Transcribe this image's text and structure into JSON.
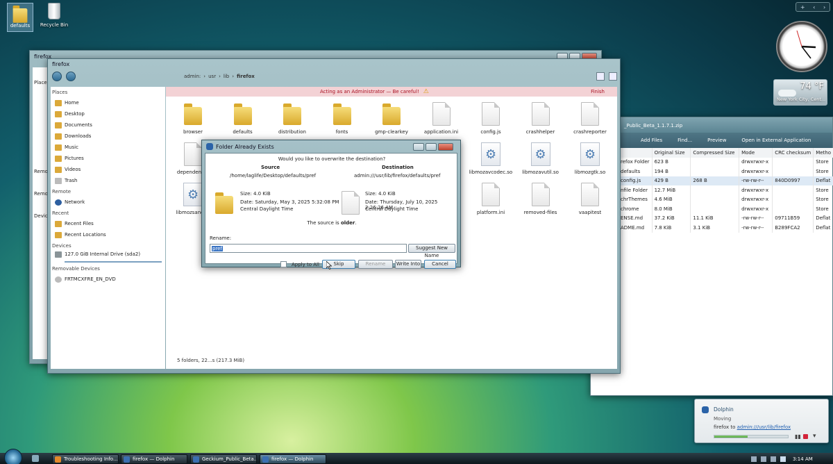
{
  "desktop": {
    "icons": [
      {
        "label": "defaults",
        "icon": "folder-icon"
      },
      {
        "label": "Recycle Bin",
        "icon": "recycle-bin-icon"
      }
    ]
  },
  "sidebar_gadget": {
    "plus": "+",
    "weather": {
      "temp": "74 °F",
      "location": "New York City, Cent..."
    }
  },
  "back_window": {
    "title": "firefox",
    "side_fragments": [
      "Place",
      "Remo",
      "Remo",
      "Devic"
    ]
  },
  "archive_window": {
    "title_fragment": "_Public_Beta_1.1.7.1.zip",
    "toolbar": [
      "Add Files",
      "Find...",
      "Preview",
      "Open in External Application"
    ],
    "columns": [
      "Original Size",
      "Compressed Size",
      "Mode",
      "CRC checksum",
      "Metho"
    ],
    "rows": [
      [
        "refox Folder",
        "623 B",
        "",
        "drwxrwxr-x",
        "",
        "Store"
      ],
      [
        "defaults",
        "194 B",
        "",
        "drwxrwxr-x",
        "",
        "Store"
      ],
      [
        "config.js",
        "429 B",
        "268 B",
        "-rw-rw-r--",
        "840D0997",
        "Deflat"
      ],
      [
        "nfile Folder",
        "12.7 MiB",
        "",
        "drwxrwxr-x",
        "",
        "Store"
      ],
      [
        "chrThemes",
        "4.6 MiB",
        "",
        "drwxrwxr-x",
        "",
        "Store"
      ],
      [
        "chrome",
        "8.0 MiB",
        "",
        "drwxrwxr-x",
        "",
        "Store"
      ],
      [
        "ENSE.md",
        "37.2 KiB",
        "11.1 KiB",
        "-rw-rw-r--",
        "09711B59",
        "Deflat"
      ],
      [
        "ADME.md",
        "7.8 KiB",
        "3.1 KiB",
        "-rw-rw-r--",
        "B289FCA2",
        "Deflat"
      ]
    ]
  },
  "dolphin": {
    "title": "firefox",
    "breadcrumb": [
      "admin:",
      "usr",
      "lib",
      "firefox"
    ],
    "admin_banner": "Acting as an Administrator — Be careful!",
    "admin_finish": "Finish",
    "places_header": "Places",
    "places": [
      "Home",
      "Desktop",
      "Documents",
      "Downloads",
      "Music",
      "Pictures",
      "Videos",
      "Trash"
    ],
    "remote_header": "Remote",
    "remote": [
      "Network"
    ],
    "recent_header": "Recent",
    "recent": [
      "Recent Files",
      "Recent Locations"
    ],
    "devices_header": "Devices",
    "devices": [
      "127.0 GiB Internal Drive (sda2)"
    ],
    "removable_header": "Removable Devices",
    "removable": [
      "FRTMCXFRE_EN_DVD"
    ],
    "files": [
      {
        "name": "browser",
        "kind": "folder"
      },
      {
        "name": "defaults",
        "kind": "folder"
      },
      {
        "name": "distribution",
        "kind": "folder"
      },
      {
        "name": "fonts",
        "kind": "folder"
      },
      {
        "name": "gmp-clearkey",
        "kind": "folder"
      },
      {
        "name": "application.ini",
        "kind": "file"
      },
      {
        "name": "config.js",
        "kind": "file"
      },
      {
        "name": "crashhelper",
        "kind": "file"
      },
      {
        "name": "crashreporter",
        "kind": "file"
      },
      {
        "name": "dependentlib",
        "kind": "file"
      },
      {
        "name": "libmozavcodec.so",
        "kind": "gear"
      },
      {
        "name": "libmozavutil.so",
        "kind": "gear"
      },
      {
        "name": "libmozgtk.so",
        "kind": "gear"
      },
      {
        "name": "libmozsandbo",
        "kind": "gear"
      },
      {
        "name": "platform.ini",
        "kind": "file"
      },
      {
        "name": "removed-files",
        "kind": "file"
      },
      {
        "name": "vaapitest",
        "kind": "file"
      }
    ],
    "status": "5 folders, 22...s (217.3 MiB)"
  },
  "dialog": {
    "title": "Folder Already Exists",
    "question": "Would you like to overwrite the destination?",
    "source_label": "Source",
    "source_path": "/home/laglife/Desktop/defaults/pref",
    "source_size": "Size: 4.0 KiB",
    "source_date": "Date: Saturday, May 3, 2025 5:32:08 PM",
    "source_tz": "Central Daylight Time",
    "dest_label": "Destination",
    "dest_path": "admin:///usr/lib/firefox/defaults/pref",
    "dest_size": "Size: 4.0 KiB",
    "dest_date": "Date: Thursday, July 10, 2025 2:26:26 AM",
    "dest_tz": "Central Daylight Time",
    "older_prefix": "The source is ",
    "older_word": "older",
    "older_suffix": ".",
    "rename_label": "Rename:",
    "rename_value": "pref",
    "suggest": "Suggest New Name",
    "apply_all": "Apply to All",
    "skip": "Skip",
    "rename": "Rename",
    "write_into": "Write Into",
    "cancel": "Cancel"
  },
  "notification": {
    "title": "Dolphin",
    "subtitle": "Moving",
    "text_prefix": "firefox to ",
    "link": "admin:///usr/lib/firefox",
    "progress": 0.45
  },
  "taskbar": {
    "items": [
      "Troubleshooting Info...",
      "firefox — Dolphin",
      "Geckium_Public_Beta...",
      "firefox — Dolphin"
    ],
    "active_index": 3,
    "time": "3:14 AM"
  }
}
